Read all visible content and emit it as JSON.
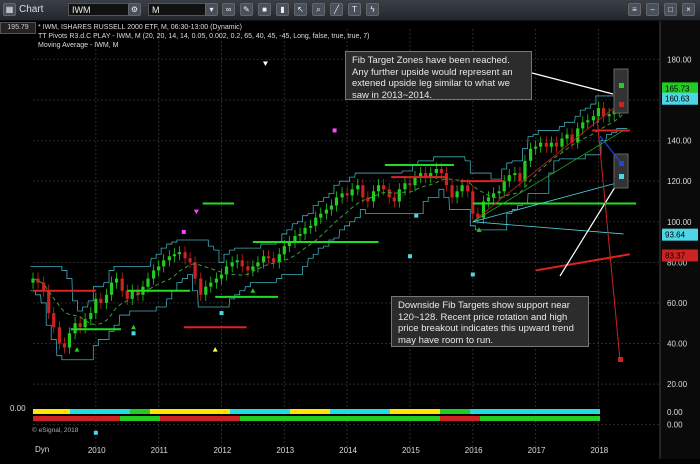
{
  "toolbar": {
    "app_label": "Chart",
    "symbol": "IWM",
    "interval": "M",
    "price_label": "195.79"
  },
  "indicators": [
    "* IWM, ISHARES RUSSELL 2000 ETF, M, 06:30-13:00 (Dynamic)",
    "TT Pivots R3.d.C PLAY - IWM, M (20, 20, 14, 14, 0.05, 0.002, 0.2, 65, 40, 45, -45, Long, false, true, true, 7)",
    "Moving Average - IWM, M"
  ],
  "annotations": {
    "top_note": "Fib Target Zones have been reached.\nAny further upside would represent an\nextened upside leg similar to what we\nsaw in 2013~2014.",
    "bottom_note": "Downside Fib Targets show support near\n120~128.  Recent price rotation and high\nprice breakout indicates this upward trend\nmay have room to run."
  },
  "footer": {
    "copyright": "© eSignal, 2018",
    "dyn_label": "Dyn"
  },
  "colors": {
    "up": "#22cc22",
    "down": "#cc2222",
    "pivot": "#4fd6e6",
    "target_line": "#22dd22",
    "stop_line": "#dd2222"
  },
  "chart_data": {
    "type": "candlestick",
    "x_ticks": [
      "2010",
      "2011",
      "2012",
      "2013",
      "2014",
      "2015",
      "2016",
      "2017",
      "2018"
    ],
    "x_range": [
      2009.0,
      2018.9
    ],
    "y_ticks": [
      0,
      20,
      40,
      60,
      80,
      100,
      120,
      140,
      160,
      180
    ],
    "y_range": [
      -12,
      195
    ],
    "price_badges": [
      {
        "value": "165.73",
        "color": "#22cc22"
      },
      {
        "value": "160.63",
        "color": "#4fd6e6"
      },
      {
        "value": "93.64",
        "color": "#4fd6e6"
      },
      {
        "value": "83.37",
        "color": "#cc2222"
      }
    ],
    "closes": [
      [
        2009.0,
        72
      ],
      [
        2009.08,
        70
      ],
      [
        2009.17,
        66
      ],
      [
        2009.25,
        55
      ],
      [
        2009.33,
        48
      ],
      [
        2009.42,
        40
      ],
      [
        2009.5,
        38
      ],
      [
        2009.58,
        45
      ],
      [
        2009.67,
        50
      ],
      [
        2009.75,
        48
      ],
      [
        2009.83,
        52
      ],
      [
        2009.92,
        55
      ],
      [
        2010.0,
        62
      ],
      [
        2010.08,
        60
      ],
      [
        2010.17,
        64
      ],
      [
        2010.25,
        70
      ],
      [
        2010.33,
        72
      ],
      [
        2010.42,
        66
      ],
      [
        2010.5,
        62
      ],
      [
        2010.58,
        66
      ],
      [
        2010.67,
        64
      ],
      [
        2010.75,
        68
      ],
      [
        2010.83,
        72
      ],
      [
        2010.92,
        76
      ],
      [
        2011.0,
        78
      ],
      [
        2011.08,
        81
      ],
      [
        2011.17,
        83
      ],
      [
        2011.25,
        84
      ],
      [
        2011.33,
        85
      ],
      [
        2011.42,
        82
      ],
      [
        2011.5,
        80
      ],
      [
        2011.58,
        72
      ],
      [
        2011.67,
        64
      ],
      [
        2011.75,
        68
      ],
      [
        2011.83,
        70
      ],
      [
        2011.92,
        72
      ],
      [
        2012.0,
        74
      ],
      [
        2012.08,
        78
      ],
      [
        2012.17,
        80
      ],
      [
        2012.25,
        81
      ],
      [
        2012.33,
        78
      ],
      [
        2012.42,
        76
      ],
      [
        2012.5,
        78
      ],
      [
        2012.58,
        80
      ],
      [
        2012.67,
        83
      ],
      [
        2012.75,
        82
      ],
      [
        2012.83,
        80
      ],
      [
        2012.92,
        84
      ],
      [
        2013.0,
        88
      ],
      [
        2013.08,
        90
      ],
      [
        2013.17,
        93
      ],
      [
        2013.25,
        94
      ],
      [
        2013.33,
        97
      ],
      [
        2013.42,
        98
      ],
      [
        2013.5,
        102
      ],
      [
        2013.58,
        104
      ],
      [
        2013.67,
        106
      ],
      [
        2013.75,
        108
      ],
      [
        2013.83,
        112
      ],
      [
        2013.92,
        114
      ],
      [
        2014.0,
        113
      ],
      [
        2014.08,
        116
      ],
      [
        2014.17,
        118
      ],
      [
        2014.25,
        112
      ],
      [
        2014.33,
        110
      ],
      [
        2014.42,
        115
      ],
      [
        2014.5,
        118
      ],
      [
        2014.58,
        116
      ],
      [
        2014.67,
        112
      ],
      [
        2014.75,
        110
      ],
      [
        2014.83,
        116
      ],
      [
        2014.92,
        119
      ],
      [
        2015.0,
        118
      ],
      [
        2015.08,
        122
      ],
      [
        2015.17,
        124
      ],
      [
        2015.25,
        122
      ],
      [
        2015.33,
        124
      ],
      [
        2015.42,
        126
      ],
      [
        2015.5,
        124
      ],
      [
        2015.58,
        118
      ],
      [
        2015.67,
        112
      ],
      [
        2015.75,
        115
      ],
      [
        2015.83,
        118
      ],
      [
        2015.92,
        115
      ],
      [
        2016.0,
        104
      ],
      [
        2016.08,
        102
      ],
      [
        2016.17,
        110
      ],
      [
        2016.25,
        112
      ],
      [
        2016.33,
        114
      ],
      [
        2016.42,
        115
      ],
      [
        2016.5,
        120
      ],
      [
        2016.58,
        123
      ],
      [
        2016.67,
        124
      ],
      [
        2016.75,
        120
      ],
      [
        2016.83,
        130
      ],
      [
        2016.92,
        136
      ],
      [
        2017.0,
        137
      ],
      [
        2017.08,
        139
      ],
      [
        2017.17,
        137
      ],
      [
        2017.25,
        139
      ],
      [
        2017.33,
        137
      ],
      [
        2017.42,
        141
      ],
      [
        2017.5,
        143
      ],
      [
        2017.58,
        139
      ],
      [
        2017.67,
        146
      ],
      [
        2017.75,
        149
      ],
      [
        2017.83,
        150
      ],
      [
        2017.92,
        152
      ],
      [
        2018.0,
        156
      ],
      [
        2018.08,
        152
      ],
      [
        2018.17,
        153
      ],
      [
        2018.25,
        155
      ],
      [
        2018.33,
        160
      ],
      [
        2018.42,
        166
      ]
    ]
  }
}
